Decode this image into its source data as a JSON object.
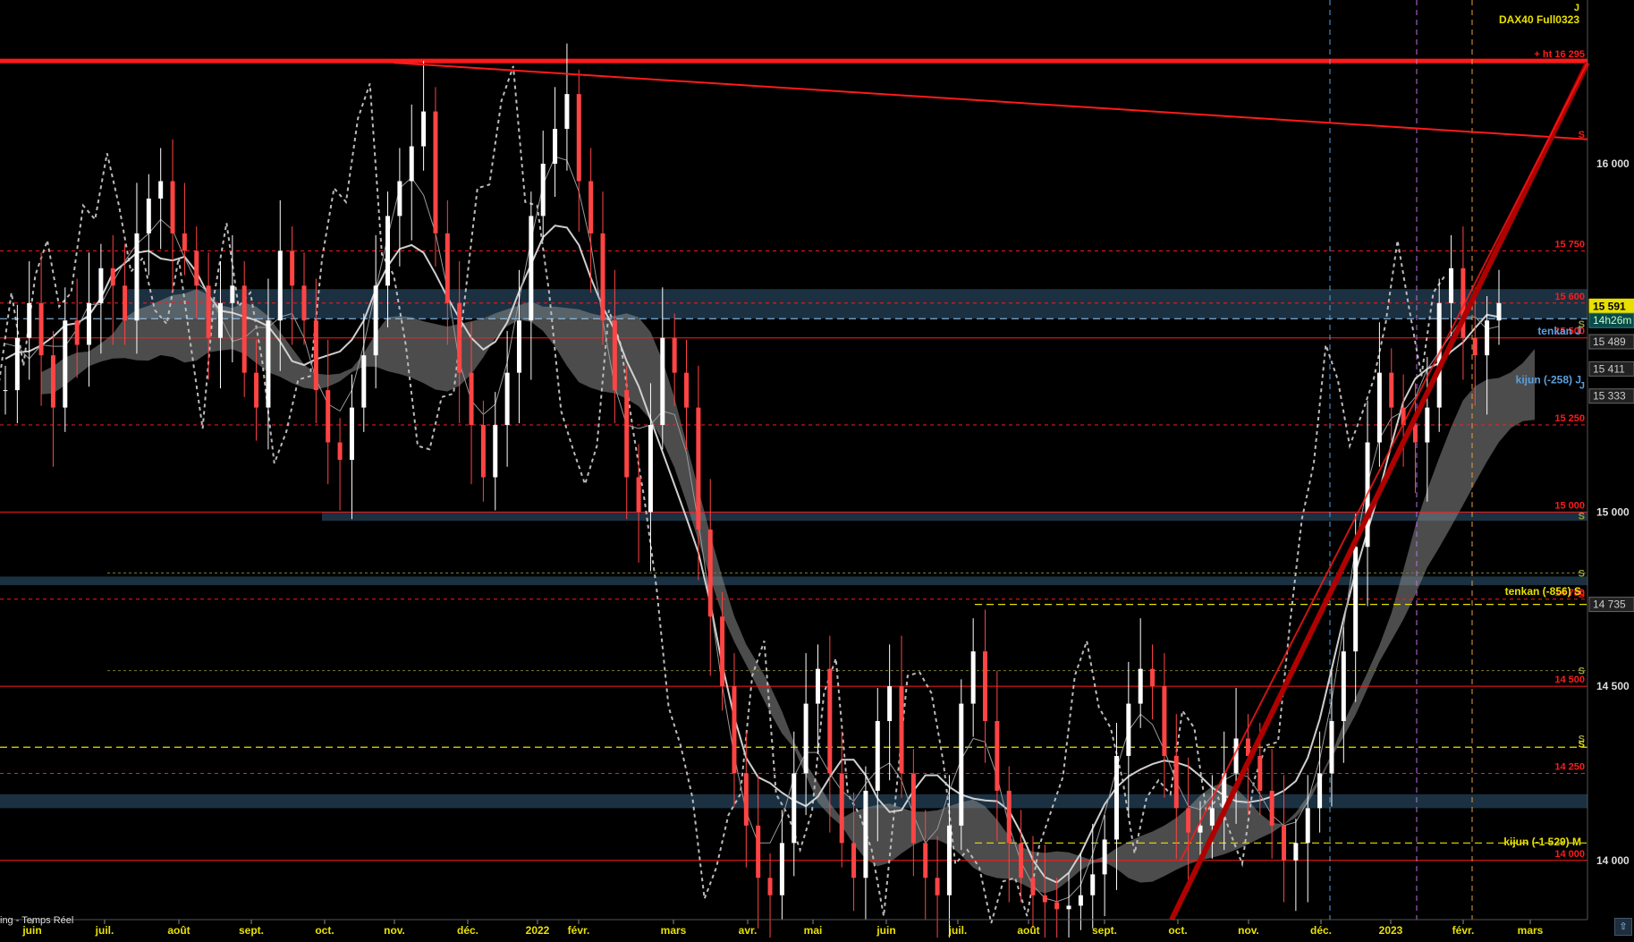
{
  "header": {
    "timeframe": "J",
    "instrument": "DAX40 Full0323"
  },
  "status_text": "ing - Temps Réel",
  "colors": {
    "background": "#000000",
    "red": "#ff1a1a",
    "trendline": "#b00000",
    "yellow": "#e8e000",
    "blue": "#5aa0e0",
    "cloud": "#8a8a8a",
    "band": "#203a4c",
    "price_up": "#ffffff",
    "price_down": "#ff4444"
  },
  "chart_data": {
    "type": "line",
    "title": "DAX40 Full0323",
    "xlabel": "",
    "ylabel": "",
    "ylim": [
      13830,
      16470
    ],
    "x_ticks": [
      "juin",
      "juil.",
      "août",
      "sept.",
      "oct.",
      "nov.",
      "déc.",
      "2022",
      "févr.",
      "mars",
      "avr.",
      "mai",
      "juin",
      "juil.",
      "août",
      "sept.",
      "oct.",
      "nov.",
      "déc.",
      "2023",
      "févr.",
      "mars"
    ],
    "y_ticks": [
      14000,
      14500,
      15000,
      16000
    ],
    "price_labels": [
      {
        "text": "15 591",
        "value": 15591,
        "style": "last"
      },
      {
        "text": "14h26m",
        "value": 15550,
        "style": "timer"
      },
      {
        "text": "15 489",
        "value": 15489,
        "style": "gray"
      },
      {
        "text": "15 411",
        "value": 15411,
        "style": "gray"
      },
      {
        "text": "15 333",
        "value": 15333,
        "style": "gray"
      },
      {
        "text": "14 735",
        "value": 14735,
        "style": "gray"
      }
    ],
    "levels": [
      {
        "value": 16295,
        "label": "+ ht 16 295",
        "style": "solid",
        "color": "#ff1a1a"
      },
      {
        "value": 15750,
        "label": "15 750",
        "style": "dashed",
        "color": "#ff1a1a"
      },
      {
        "value": 15600,
        "label": "15 600",
        "style": "dashed",
        "color": "#ff1a1a"
      },
      {
        "value": 15500,
        "label": "15 500",
        "style": "solid",
        "color": "#ff1a1a"
      },
      {
        "value": 15250,
        "label": "15 250",
        "style": "dashed",
        "color": "#ff1a1a"
      },
      {
        "value": 15000,
        "label": "15 000",
        "style": "solid",
        "color": "#ff1a1a"
      },
      {
        "value": 14750,
        "label": "14 750",
        "style": "dashed",
        "color": "#ff1a1a"
      },
      {
        "value": 14500,
        "label": "14 500",
        "style": "solid",
        "color": "#ff1a1a"
      },
      {
        "value": 14250,
        "label": "14 250",
        "style": "dashed",
        "color": "#ff1a1a"
      },
      {
        "value": 14000,
        "label": "14 000",
        "style": "solid",
        "color": "#ff1a1a"
      }
    ],
    "support_marks": [
      {
        "value": 15540,
        "label": "S",
        "color": "#9aa040"
      },
      {
        "value": 14990,
        "label": "S",
        "color": "#9aa040"
      },
      {
        "value": 14825,
        "label": "S",
        "color": "#9aa040"
      },
      {
        "value": 14545,
        "label": "S",
        "color": "#9aa040"
      },
      {
        "value": 14350,
        "label": "S",
        "color": "#9aa040"
      },
      {
        "value": 14335,
        "label": "S",
        "color": "#e8e000"
      },
      {
        "value": 16085,
        "label": "S",
        "color": "#ff1a1a"
      },
      {
        "value": 14765,
        "label": "S",
        "color": "#ff1a1a"
      },
      {
        "value": 15365,
        "label": "J",
        "color": "#5aa0e0"
      }
    ],
    "annotations": [
      {
        "text": "tenkan J",
        "value": 15509,
        "color": "#5aa0e0"
      },
      {
        "text": "kijun (-258) J",
        "value": 15370,
        "color": "#5aa0e0"
      },
      {
        "text": "tenkan (-856) S",
        "value": 14762,
        "color": "#e8e000"
      },
      {
        "text": "kijun (-1 529) M",
        "value": 14043,
        "color": "#e8e000"
      }
    ],
    "series": [
      {
        "values": [
          15350,
          15500,
          15600,
          15450,
          15300,
          15550,
          15480,
          15600,
          15700,
          15650,
          15550,
          15800,
          15900,
          15950,
          15800,
          15750,
          15650,
          15500,
          15600,
          15650,
          15400,
          15300,
          15550,
          15750,
          15650,
          15550,
          15350,
          15200,
          15150,
          15300,
          15450,
          15650,
          15850,
          15950,
          16050,
          16150,
          15800,
          15600,
          15400,
          15250,
          15100,
          15250,
          15400,
          15550,
          15850,
          16000,
          16100,
          16200,
          15950,
          15800,
          15550,
          15350,
          15100,
          15000,
          15250,
          15500,
          15400,
          15300,
          14950,
          14700,
          14500,
          14250,
          14100,
          13950,
          13900,
          14050,
          14250,
          14450,
          14550,
          14250,
          14050,
          13950,
          14200,
          14400,
          14500,
          14250,
          14050,
          13950,
          13900,
          14100,
          14450,
          14600,
          14400,
          14200,
          14050,
          13950,
          13900,
          13880,
          13860,
          13870,
          13900,
          13960,
          14060,
          14300,
          14450,
          14550,
          14500,
          14300,
          14150,
          14080,
          14100,
          14150,
          14250,
          14350,
          14300,
          14200,
          14100,
          14000,
          14050,
          14150,
          14250,
          14400,
          14600,
          14900,
          15200,
          15400,
          15300,
          15250,
          15200,
          15300,
          15600,
          15700,
          15500,
          15450,
          15550,
          15600
        ]
      }
    ]
  }
}
